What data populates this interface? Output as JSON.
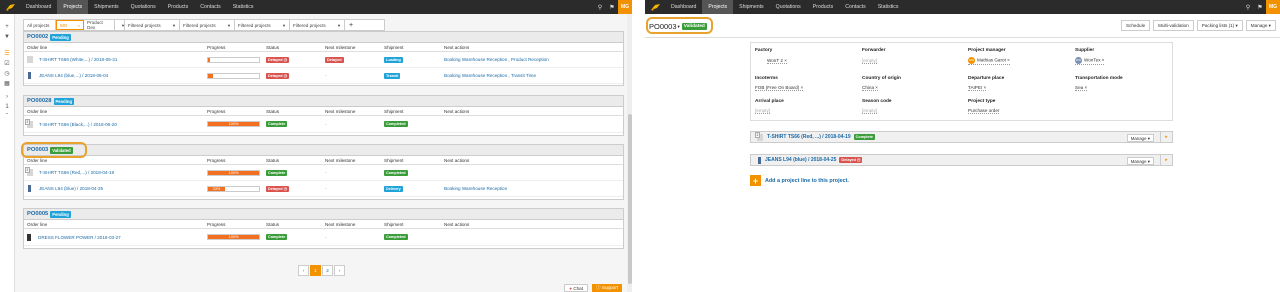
{
  "nav": {
    "items": [
      "Dashboard",
      "Projects",
      "Shipments",
      "Quotations",
      "Products",
      "Contacts",
      "Statistics"
    ],
    "active": "Projects",
    "user_initials": "MG"
  },
  "sidebar": {
    "icons": [
      "plus-icon",
      "filter-icon",
      "list-icon",
      "check-list-icon",
      "clock-icon",
      "table-icon",
      "chevron-right-icon",
      "chevron-up-icon"
    ],
    "page_number": "1"
  },
  "filters": [
    {
      "label": "All projects"
    },
    {
      "label": "MG"
    },
    {
      "label": "Product Dev"
    },
    {
      "label": "Filtered projects"
    },
    {
      "label": "Filtered projects"
    },
    {
      "label": "Filtered projects"
    },
    {
      "label": "Filtered projects"
    }
  ],
  "columns": [
    "Order line",
    "Progress",
    "Status",
    "Next milestone",
    "Shipment",
    "Next actions"
  ],
  "projects": [
    {
      "id": "PO0002",
      "badge": "Pending",
      "lines": [
        {
          "name": "T-SHIRT TS66 (White,...) / 2018-05-31",
          "progress": 3,
          "progress_label": "",
          "status": "Delayed",
          "milestone": "Delayed",
          "shipment": "Loading",
          "actions": "Booking Warehouse Reception , Product Reception"
        },
        {
          "name": "JEANS L94 (blue,...) / 2018-06-04",
          "progress": 10,
          "progress_label": "",
          "status": "Delayed",
          "milestone": "-",
          "shipment": "Transit",
          "actions": "Booking Warehouse Reception , Transit Time"
        }
      ]
    },
    {
      "id": "PO00028",
      "badge": "Pending",
      "lines": [
        {
          "name": "T-SHIRT TS66 (Black,...) / 2018-06-20",
          "qty": "2",
          "progress": 100,
          "progress_label": "100%",
          "status": "Complete",
          "milestone": "-",
          "shipment": "Completed",
          "actions": ""
        }
      ]
    },
    {
      "id": "PO0003",
      "badge": "Validated",
      "lines": [
        {
          "name": "T-SHIRT TS66 (Red,...) / 2018-04-19",
          "qty": "2",
          "progress": 100,
          "progress_label": "100%",
          "status": "Complete",
          "milestone": "-",
          "shipment": "Completed",
          "actions": ""
        },
        {
          "name": "JEANS L94 (blue) / 2018-04-25",
          "progress": 33,
          "progress_label": "33%",
          "status": "Delayed",
          "milestone": "-",
          "shipment": "Delivery",
          "actions": "Booking Warehouse Reception"
        }
      ]
    },
    {
      "id": "PO0005",
      "badge": "Pending",
      "lines": [
        {
          "name": "DRESS FLOWER POWER / 2018-03-27",
          "progress": 100,
          "progress_label": "100%",
          "status": "Complete",
          "milestone": "-",
          "shipment": "Completed",
          "actions": ""
        }
      ]
    }
  ],
  "pagination": {
    "prev": "‹",
    "pages": [
      "1",
      "2"
    ],
    "next": "›",
    "current": "1"
  },
  "footer": {
    "chat": "Chat",
    "support": "Support"
  },
  "detail": {
    "title": "PO0003",
    "badge": "Validated",
    "buttons": [
      "Schedule",
      "Multi-validation",
      "Packing lists (1)",
      "Manage"
    ],
    "fields": [
      {
        "label": "Factory",
        "value": "WonT 2"
      },
      {
        "label": "Forwarder",
        "value": "[empty]"
      },
      {
        "label": "Project manager",
        "value": "Mathias Garot",
        "avatar": "MG"
      },
      {
        "label": "Supplier",
        "value": "WonTex",
        "avatar": "WO"
      },
      {
        "label": "Incoterms",
        "value": "FOB (Free On Board)"
      },
      {
        "label": "Country of origin",
        "value": "China"
      },
      {
        "label": "Departure place",
        "value": "TAIPEI"
      },
      {
        "label": "Transportation mode",
        "value": "Sea"
      },
      {
        "label": "Arrival place",
        "value": "[empty]"
      },
      {
        "label": "Season code",
        "value": "[empty]"
      },
      {
        "label": "Project type",
        "value": "Purchase order"
      }
    ],
    "lines": [
      {
        "name": "T-SHIRT TS66 (Red, ...) / 2018-04-19",
        "qty": "2",
        "status": "Complete",
        "manage": "Manage"
      },
      {
        "name": "JEANS L94 (blue) / 2018-04-25",
        "status": "Delayed",
        "manage": "Manage"
      }
    ],
    "add_line": "Add a project line to this project."
  }
}
